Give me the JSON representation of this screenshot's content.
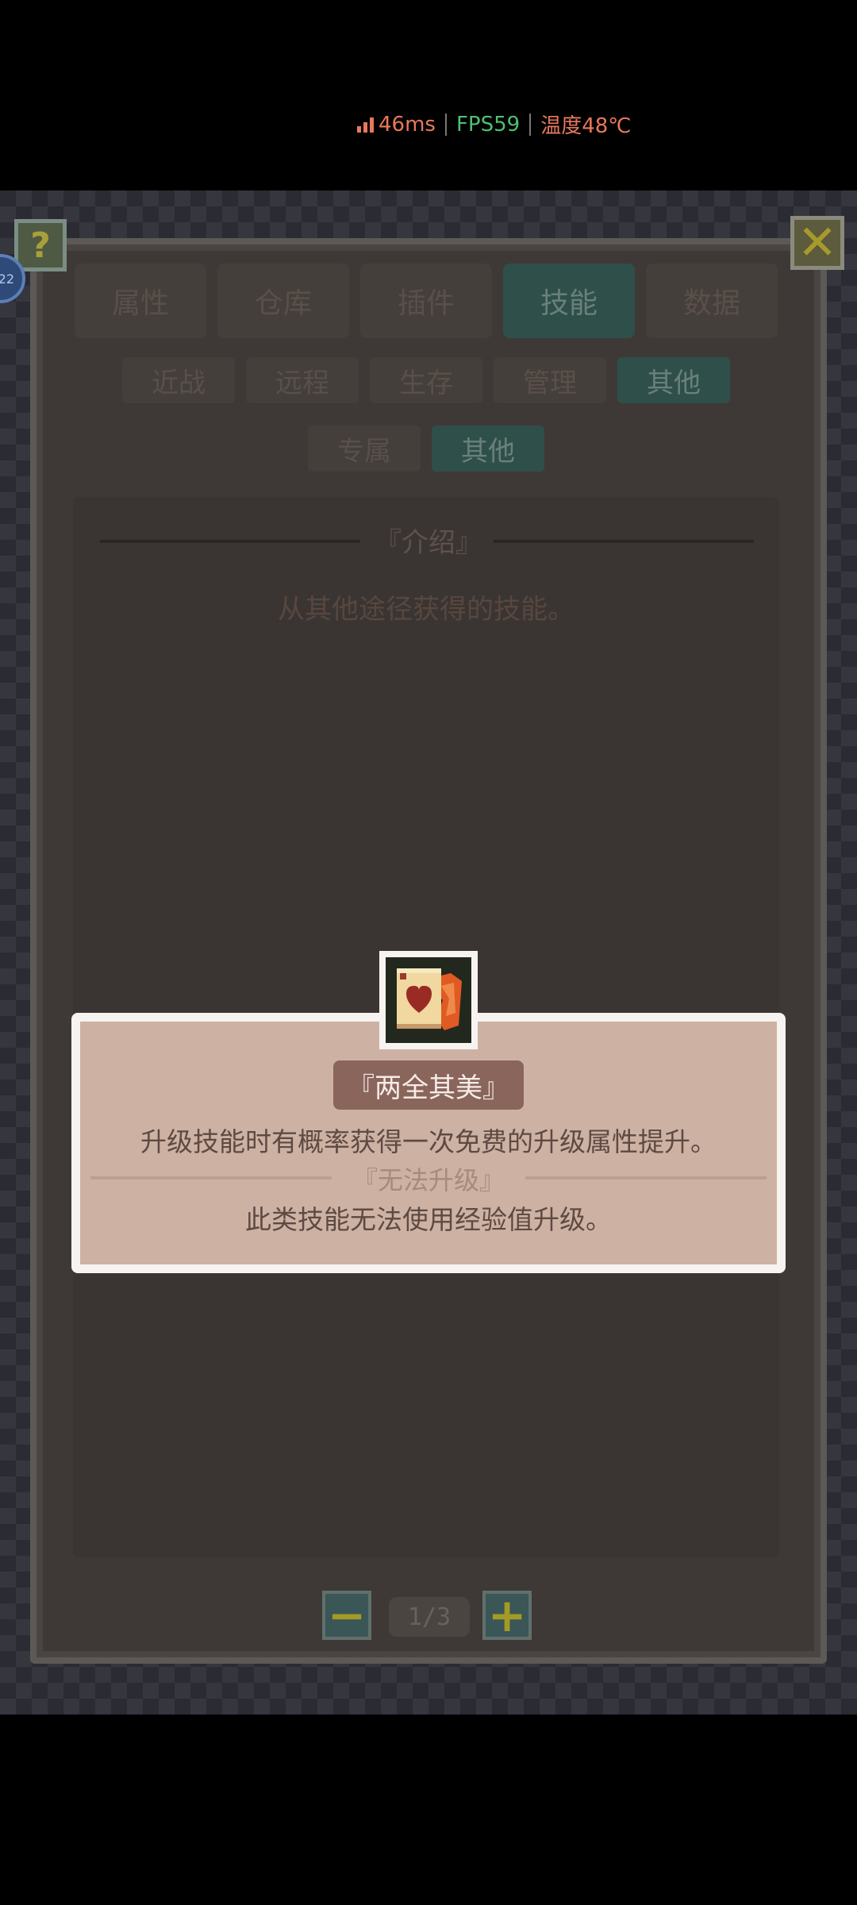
{
  "perf": {
    "ping": "46ms",
    "fps": "FPS59",
    "temperature": "温度48℃"
  },
  "colors": {
    "ping": "#e8785a",
    "fps": "#4fbf73",
    "temperature": "#e8785a"
  },
  "level_badge": "22",
  "buttons": {
    "help": "?",
    "close": "✕",
    "prev": "−",
    "next": "+"
  },
  "main_tabs": [
    {
      "label": "属性",
      "active": false
    },
    {
      "label": "仓库",
      "active": false
    },
    {
      "label": "插件",
      "active": false
    },
    {
      "label": "技能",
      "active": true
    },
    {
      "label": "数据",
      "active": false
    }
  ],
  "sub_tabs": [
    {
      "label": "近战",
      "active": false
    },
    {
      "label": "远程",
      "active": false
    },
    {
      "label": "生存",
      "active": false
    },
    {
      "label": "管理",
      "active": false
    },
    {
      "label": "其他",
      "active": true
    }
  ],
  "sub_sub_tabs": [
    {
      "label": "专属",
      "active": false
    },
    {
      "label": "其他",
      "active": true
    }
  ],
  "intro": {
    "title": "『介绍』",
    "text": "从其他途径获得的技能。"
  },
  "pager": {
    "text": "1/3"
  },
  "popup": {
    "icon": "heart-card-icon",
    "skill_name": "『两全其美』",
    "description": "升级技能时有概率获得一次免费的升级属性提升。",
    "cant_upgrade_title": "『无法升级』",
    "cant_upgrade_text": "此类技能无法使用经验值升级。"
  }
}
